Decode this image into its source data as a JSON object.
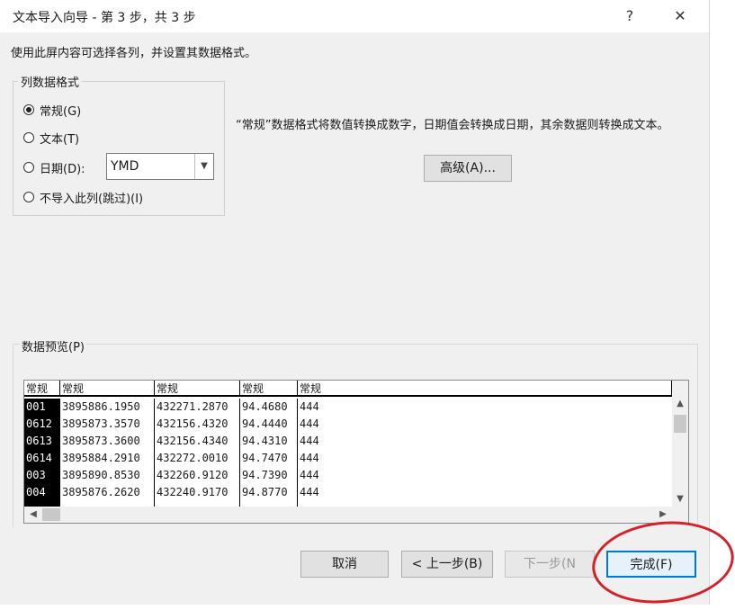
{
  "window": {
    "title": "文本导入向导 - 第 3 步，共 3 步",
    "help_glyph": "?",
    "close_glyph": "✕"
  },
  "instructions": "使用此屏内容可选择各列，并设置其数据格式。",
  "column_format": {
    "legend": "列数据格式",
    "options": [
      {
        "label": "常规(G)",
        "checked": true
      },
      {
        "label": "文本(T)",
        "checked": false
      },
      {
        "label": "日期(D):",
        "checked": false
      },
      {
        "label": "不导入此列(跳过)(I)",
        "checked": false
      }
    ],
    "date_format": "YMD"
  },
  "description": "“常规”数据格式将数值转换成数字，日期值会转换成日期，其余数据则转换成文本。",
  "advanced_button": "高级(A)...",
  "preview": {
    "label": "数据预览(P)",
    "headers": [
      "常规",
      "常规",
      "常规",
      "常规",
      "常规"
    ],
    "rows": [
      [
        "001",
        "3895886.1950",
        "432271.2870",
        "94.4680",
        "444"
      ],
      [
        "0612",
        "3895873.3570",
        "432156.4320",
        "94.4440",
        "444"
      ],
      [
        "0613",
        "3895873.3600",
        "432156.4340",
        "94.4310",
        "444"
      ],
      [
        "0614",
        "3895884.2910",
        "432272.0010",
        "94.7470",
        "444"
      ],
      [
        "003",
        "3895890.8530",
        "432260.9120",
        "94.7390",
        "444"
      ],
      [
        "004",
        "3895876.2620",
        "432240.9170",
        "94.8770",
        "444"
      ]
    ]
  },
  "buttons": {
    "cancel": "取消",
    "back": "< 上一步(B)",
    "next": "下一步(N",
    "finish": "完成(F)"
  },
  "colors": {
    "annotation_circle": "#d6202a",
    "dialog_bg": "#f0f0f0"
  },
  "icons": {
    "scroll_up": "▲",
    "scroll_down": "▼",
    "scroll_left": "◀",
    "scroll_right": "▶",
    "dropdown": "▼"
  }
}
